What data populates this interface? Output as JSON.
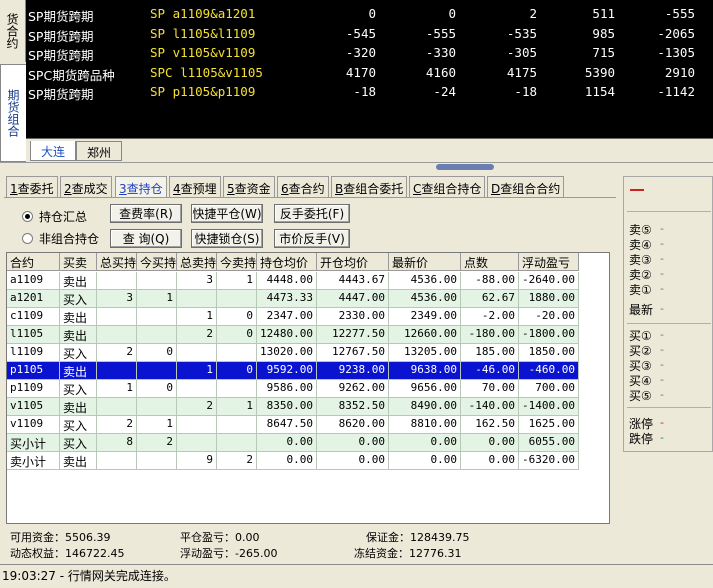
{
  "vertical_tabs": [
    {
      "label": "货合约",
      "active": false
    },
    {
      "label": "期货组合",
      "active": true
    }
  ],
  "quotes": [
    {
      "name": "SP期货跨期",
      "code": "SP a1109&a1201",
      "v1": "0",
      "v2": "0",
      "v3": "2",
      "v4": "511",
      "v5": "-555"
    },
    {
      "name": "SP期货跨期",
      "code": "SP l1105&l1109",
      "v1": "-545",
      "v2": "-555",
      "v3": "-535",
      "v4": "985",
      "v5": "-2065"
    },
    {
      "name": "SP期货跨期",
      "code": "SP v1105&v1109",
      "v1": "-320",
      "v2": "-330",
      "v3": "-305",
      "v4": "715",
      "v5": "-1305"
    },
    {
      "name": "SPC期货跨品种",
      "code": "SPC l1105&v1105",
      "v1": "4170",
      "v2": "4160",
      "v3": "4175",
      "v4": "5390",
      "v5": "2910"
    },
    {
      "name": "SP期货跨期",
      "code": "SP p1105&p1109",
      "v1": "-18",
      "v2": "-24",
      "v3": "-18",
      "v4": "1154",
      "v5": "-1142"
    }
  ],
  "exchange_tabs": [
    "大连",
    "郑州"
  ],
  "function_tabs": [
    {
      "key": "1",
      "label": "查委托"
    },
    {
      "key": "2",
      "label": "查成交"
    },
    {
      "key": "3",
      "label": "查持仓",
      "active": true
    },
    {
      "key": "4",
      "label": "查预埋"
    },
    {
      "key": "5",
      "label": "查资金"
    },
    {
      "key": "6",
      "label": "查合约"
    },
    {
      "key": "B",
      "label": "查组合委托"
    },
    {
      "key": "C",
      "label": "查组合持仓"
    },
    {
      "key": "D",
      "label": "查组合合约"
    }
  ],
  "radios": {
    "summary": "持仓汇总",
    "non_combo": "非组合持仓",
    "selected": "summary"
  },
  "buttons": {
    "fee_rate": "查费率(R)",
    "query": "查 询(Q)",
    "quick_close": "快捷平仓(W)",
    "quick_lock": "快捷锁仓(S)",
    "reverse_order": "反手委托(F)",
    "market_reverse": "市价反手(V)"
  },
  "table": {
    "headers": [
      "合约",
      "买卖",
      "总买持",
      "今买持",
      "总卖持",
      "今卖持",
      "持仓均价",
      "开仓均价",
      "最新价",
      "点数",
      "浮动盈亏"
    ],
    "rows": [
      [
        "a1109",
        "卖出",
        "",
        "",
        "3",
        "1",
        "4448.00",
        "4443.67",
        "4536.00",
        "-88.00",
        "-2640.00"
      ],
      [
        "a1201",
        "买入",
        "3",
        "1",
        "",
        "",
        "4473.33",
        "4447.00",
        "4536.00",
        "62.67",
        "1880.00"
      ],
      [
        "c1109",
        "卖出",
        "",
        "",
        "1",
        "0",
        "2347.00",
        "2330.00",
        "2349.00",
        "-2.00",
        "-20.00"
      ],
      [
        "l1105",
        "卖出",
        "",
        "",
        "2",
        "0",
        "12480.00",
        "12277.50",
        "12660.00",
        "-180.00",
        "-1800.00"
      ],
      [
        "l1109",
        "买入",
        "2",
        "0",
        "",
        "",
        "13020.00",
        "12767.50",
        "13205.00",
        "185.00",
        "1850.00"
      ],
      [
        "p1105",
        "卖出",
        "",
        "",
        "1",
        "0",
        "9592.00",
        "9238.00",
        "9638.00",
        "-46.00",
        "-460.00"
      ],
      [
        "p1109",
        "买入",
        "1",
        "0",
        "",
        "",
        "9586.00",
        "9262.00",
        "9656.00",
        "70.00",
        "700.00"
      ],
      [
        "v1105",
        "卖出",
        "",
        "",
        "2",
        "1",
        "8350.00",
        "8352.50",
        "8490.00",
        "-140.00",
        "-1400.00"
      ],
      [
        "v1109",
        "买入",
        "2",
        "1",
        "",
        "",
        "8647.50",
        "8620.00",
        "8810.00",
        "162.50",
        "1625.00"
      ],
      [
        "买小计",
        "买入",
        "8",
        "2",
        "",
        "",
        "0.00",
        "0.00",
        "0.00",
        "0.00",
        "6055.00"
      ],
      [
        "卖小计",
        "卖出",
        "",
        "",
        "9",
        "2",
        "0.00",
        "0.00",
        "0.00",
        "0.00",
        "-6320.00"
      ]
    ],
    "selected_row": 5
  },
  "summary": {
    "available": "可用资金：5506.39",
    "dynamic_equity": "动态权益：146722.45",
    "close_pnl": "平仓盈亏：0.00",
    "float_pnl": "浮动盈亏：-265.00",
    "margin": "保证金：128439.75",
    "frozen": "冻结资金：12776.31"
  },
  "depth": {
    "sell": [
      "卖⑤",
      "卖④",
      "卖③",
      "卖②",
      "卖①"
    ],
    "latest": "最新",
    "buy": [
      "买①",
      "买②",
      "买③",
      "买④",
      "买⑤"
    ],
    "limit_up": "涨停",
    "limit_down": "跌停",
    "dash": "-"
  },
  "status_bar": "19:03:27 - 行情网关完成连接。",
  "colors": {
    "selected_row": "#0a14d0",
    "quote_code": "#f5e132",
    "limit_up": "#d02020",
    "limit_down": "#10a040"
  }
}
